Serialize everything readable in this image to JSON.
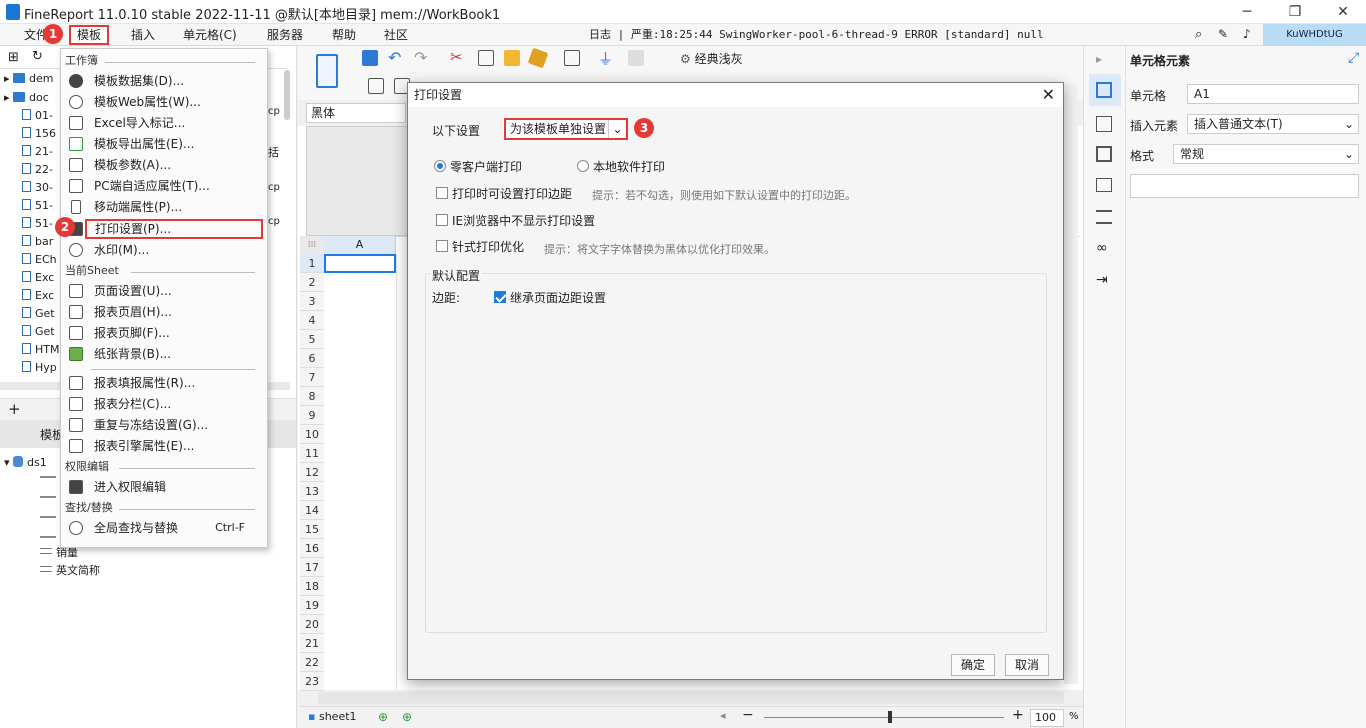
{
  "titlebar": {
    "title": "FineReport 11.0.10 stable 2022-11-11 @默认[本地目录]   mem://WorkBook1"
  },
  "menubar": {
    "items": [
      "文件",
      "模板",
      "插入",
      "单元格(C)",
      "服务器",
      "帮助",
      "社区"
    ],
    "log": "日志 | 严重:18:25:44 SwingWorker-pool-6-thread-9 ERROR [standard] null",
    "user": "KuWHDtUG"
  },
  "badges": [
    "1",
    "2",
    "3"
  ],
  "left_tree": {
    "items": [
      "dem",
      "doc",
      "01-",
      "156",
      "21-",
      "22-",
      "30-",
      "51-",
      "51-",
      "bar",
      "ECh",
      "Exc",
      "Exc",
      "Get",
      "Get",
      "HTM",
      "Hyp"
    ],
    "side_text": [
      "cp",
      "括",
      "cp",
      "cp"
    ],
    "section_label": "模板",
    "dataset": "ds1",
    "fields": [
      "销量",
      "英文简称"
    ]
  },
  "dropdown": {
    "sections": {
      "workbook": "工作簿",
      "sheet": "当前Sheet",
      "permission": "权限编辑",
      "find": "查找/替换"
    },
    "workbook_items": [
      "模板数据集(D)...",
      "模板Web属性(W)...",
      "Excel导入标记...",
      "模板导出属性(E)...",
      "模板参数(A)...",
      "PC端自适应属性(T)...",
      "移动端属性(P)...",
      "打印设置(P)...",
      "水印(M)..."
    ],
    "sheet_items": [
      "页面设置(U)...",
      "报表页眉(H)...",
      "报表页脚(F)...",
      "纸张背景(B)..."
    ],
    "sheet_items2": [
      "报表填报属性(R)...",
      "报表分栏(C)...",
      "重复与冻结设置(G)...",
      "报表引擎属性(E)..."
    ],
    "permission_item": "进入权限编辑",
    "find_item": "全局查找与替换",
    "find_shortcut": "Ctrl-F"
  },
  "toolbar": {
    "style_label": "经典浅灰",
    "font": "黑体"
  },
  "sheet": {
    "col_header": "A",
    "rows": [
      "1",
      "2",
      "3",
      "4",
      "5",
      "6",
      "7",
      "8",
      "9",
      "10",
      "11",
      "12",
      "13",
      "14",
      "15",
      "16",
      "17",
      "18",
      "19",
      "20",
      "21",
      "22",
      "23"
    ],
    "tab": "sheet1",
    "zoom": "100",
    "zoom_unit": "%"
  },
  "right_panel": {
    "title": "单元格元素",
    "cell_label": "单元格",
    "cell_value": "A1",
    "insert_label": "插入元素",
    "insert_value": "插入普通文本(T)",
    "format_label": "格式",
    "format_value": "常规"
  },
  "dialog": {
    "title": "打印设置",
    "setting_label": "以下设置",
    "setting_value": "为该模板单独设置",
    "radio_zero": "零客户端打印",
    "radio_local": "本地软件打印",
    "chk_margin": "打印时可设置打印边距",
    "chk_margin_hint": "提示：若不勾选，则使用如下默认设置中的打印边距。",
    "chk_ie": "IE浏览器中不显示打印设置",
    "chk_needle": "针式打印优化",
    "chk_needle_hint": "提示：将文字字体替换为黑体以优化打印效果。",
    "default_section": "默认配置",
    "margin_label": "边距:",
    "inherit_label": "继承页面边距设置",
    "ok": "确定",
    "cancel": "取消"
  },
  "colors": {
    "highlight": "#e53935",
    "accent": "#1e7be0"
  }
}
